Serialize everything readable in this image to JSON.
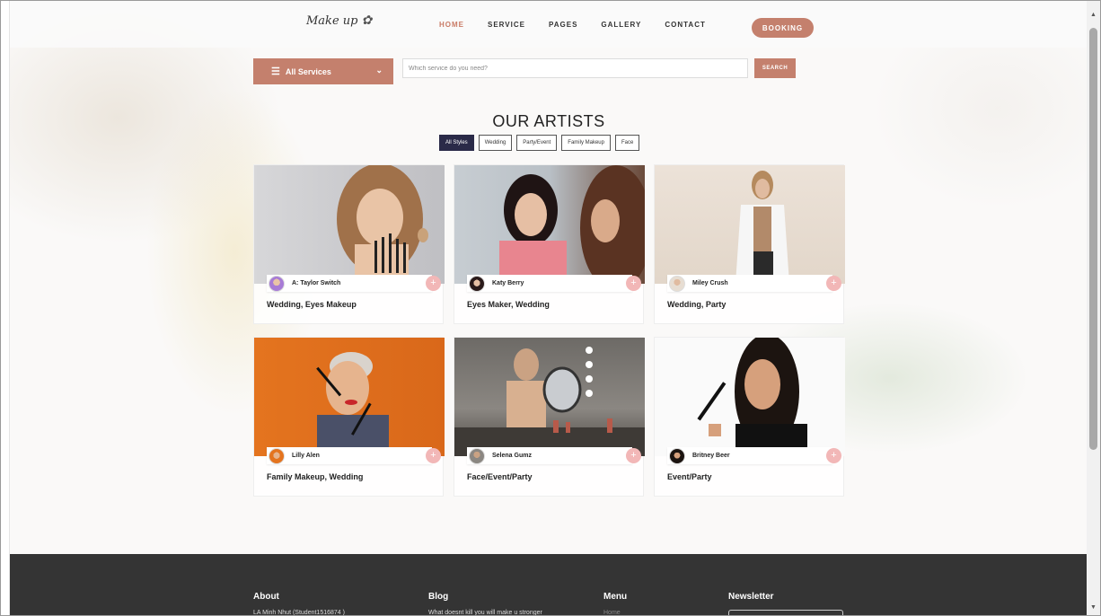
{
  "header": {
    "logo_text": "Make up",
    "nav": [
      "HOME",
      "SERVICE",
      "PAGES",
      "GALLERY",
      "CONTACT"
    ],
    "booking_label": "BOOKING"
  },
  "search": {
    "dropdown_label": "All Services",
    "placeholder": "Which service do you need?",
    "button_label": "SEARCH"
  },
  "artists": {
    "heading": "OUR ARTISTS",
    "filters": [
      "All Styles",
      "Wedding",
      "Party/Event",
      "Family Makeup",
      "Face"
    ],
    "cards": [
      {
        "name": "A: Taylor Switch",
        "specialty": "Wedding, Eyes Makeup"
      },
      {
        "name": "Katy Berry",
        "specialty": "Eyes Maker, Wedding"
      },
      {
        "name": "Miley Crush",
        "specialty": "Wedding, Party"
      },
      {
        "name": "Lilly Alen",
        "specialty": "Family Makeup, Wedding"
      },
      {
        "name": "Selena Gumz",
        "specialty": "Face/Event/Party"
      },
      {
        "name": "Britney Beer",
        "specialty": "Event/Party"
      }
    ]
  },
  "footer": {
    "about_title": "About",
    "about_text": "LA Minh Nhut (Student1516874 )",
    "blog_title": "Blog",
    "blog_text": "What doesnt kill you will make u stronger",
    "menu_title": "Menu",
    "menu_item": "Home",
    "newsletter_title": "Newsletter"
  },
  "colors": {
    "accent": "#c4806d",
    "active_nav": "#c97a65",
    "filter_active": "#2a2a48",
    "footer_bg": "#343434"
  }
}
